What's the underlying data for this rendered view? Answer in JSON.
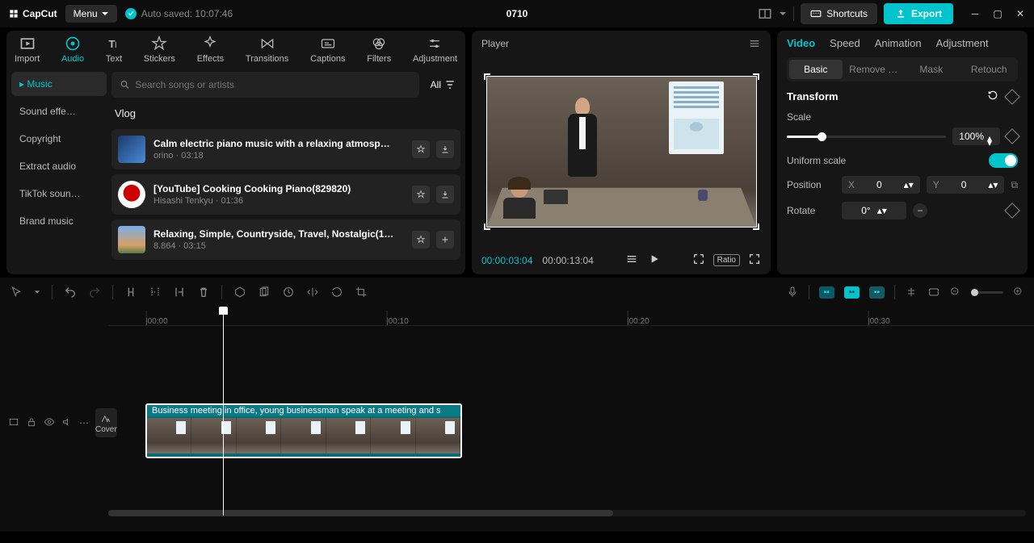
{
  "app": {
    "name": "CapCut",
    "menu": "Menu",
    "autosave": "Auto saved: 10:07:46",
    "project": "0710"
  },
  "header": {
    "shortcuts": "Shortcuts",
    "export": "Export"
  },
  "tabs": [
    "Import",
    "Audio",
    "Text",
    "Stickers",
    "Effects",
    "Transitions",
    "Captions",
    "Filters",
    "Adjustment"
  ],
  "activeTab": 1,
  "subnav": [
    "Music",
    "Sound effe…",
    "Copyright",
    "Extract audio",
    "TikTok soun…",
    "Brand music"
  ],
  "search": {
    "placeholder": "Search songs or artists",
    "all": "All"
  },
  "sectionTitle": "Vlog",
  "music": [
    {
      "title": "Calm electric piano music with a relaxing atmosp…",
      "meta": "orino · 03:18"
    },
    {
      "title": "[YouTube] Cooking Cooking Piano(829820)",
      "meta": "Hisashi Tenkyu · 01:36"
    },
    {
      "title": "Relaxing, Simple, Countryside, Travel, Nostalgic(1…",
      "meta": "8.864 · 03:15"
    }
  ],
  "player": {
    "title": "Player",
    "current": "00:00:03:04",
    "duration": "00:00:13:04",
    "ratio": "Ratio"
  },
  "inspector": {
    "tabs": [
      "Video",
      "Speed",
      "Animation",
      "Adjustment"
    ],
    "subtabs": [
      "Basic",
      "Remove …",
      "Mask",
      "Retouch"
    ],
    "transform": "Transform",
    "scale": "Scale",
    "scaleValue": "100%",
    "uniform": "Uniform scale",
    "position": "Position",
    "px": "0",
    "py": "0",
    "rotate": "Rotate",
    "rotateValue": "0°"
  },
  "timeline": {
    "marks": [
      "00:00",
      "00:10",
      "00:20",
      "00:30"
    ],
    "cover": "Cover",
    "clipLabel": "Business meeting in office, young businessman speak at a meeting and s"
  }
}
